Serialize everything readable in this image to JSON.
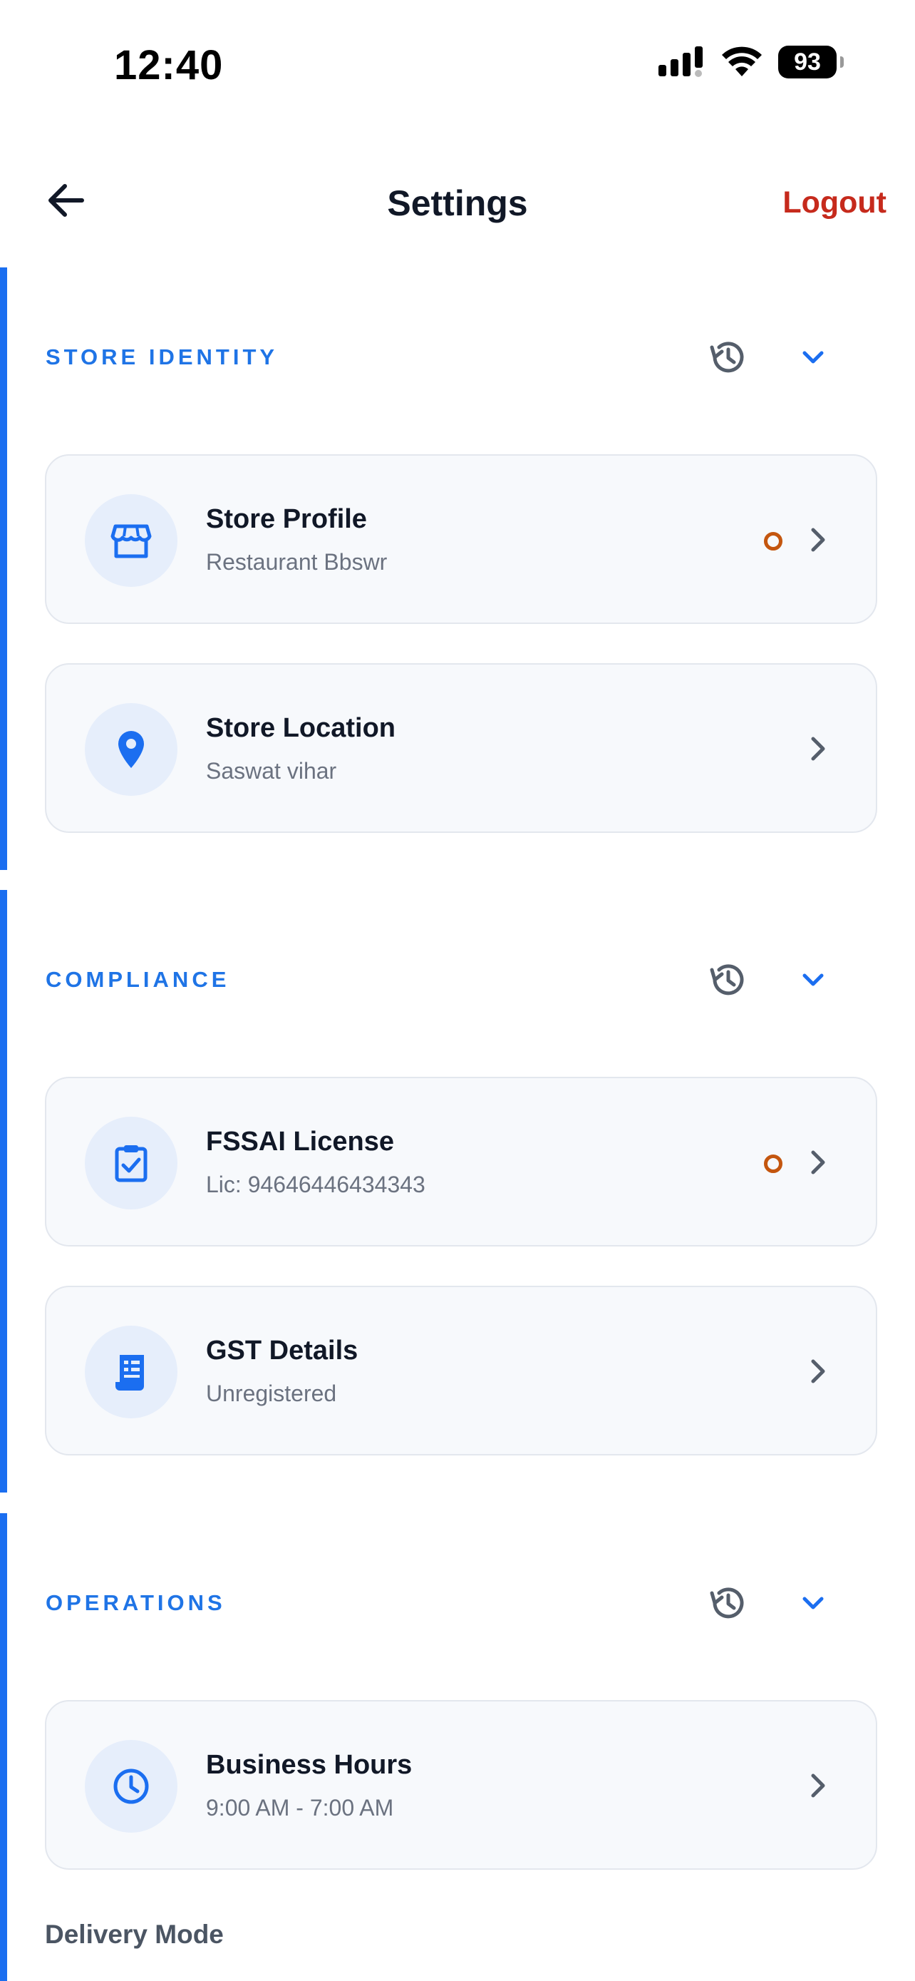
{
  "status_bar": {
    "time": "12:40",
    "battery": "93"
  },
  "header": {
    "title": "Settings",
    "logout": "Logout"
  },
  "sections": [
    {
      "title": "STORE IDENTITY",
      "cards": [
        {
          "title": "Store Profile",
          "subtitle": "Restaurant Bbswr",
          "icon": "storefront-icon",
          "pending": true
        },
        {
          "title": "Store Location",
          "subtitle": "Saswat vihar",
          "icon": "location-pin-icon",
          "pending": false
        }
      ]
    },
    {
      "title": "COMPLIANCE",
      "cards": [
        {
          "title": "FSSAI License",
          "subtitle": "Lic: 94646446434343",
          "icon": "clipboard-check-icon",
          "pending": true
        },
        {
          "title": "GST Details",
          "subtitle": "Unregistered",
          "icon": "receipt-icon",
          "pending": false
        }
      ]
    },
    {
      "title": "OPERATIONS",
      "cards": [
        {
          "title": "Business Hours",
          "subtitle": "9:00 AM - 7:00 AM",
          "icon": "clock-icon",
          "pending": false
        }
      ]
    }
  ],
  "delivery_mode_label": "Delivery Mode",
  "colors": {
    "accent": "#1b6ef0",
    "logout": "#c62a1c",
    "pending": "#c4560f"
  }
}
